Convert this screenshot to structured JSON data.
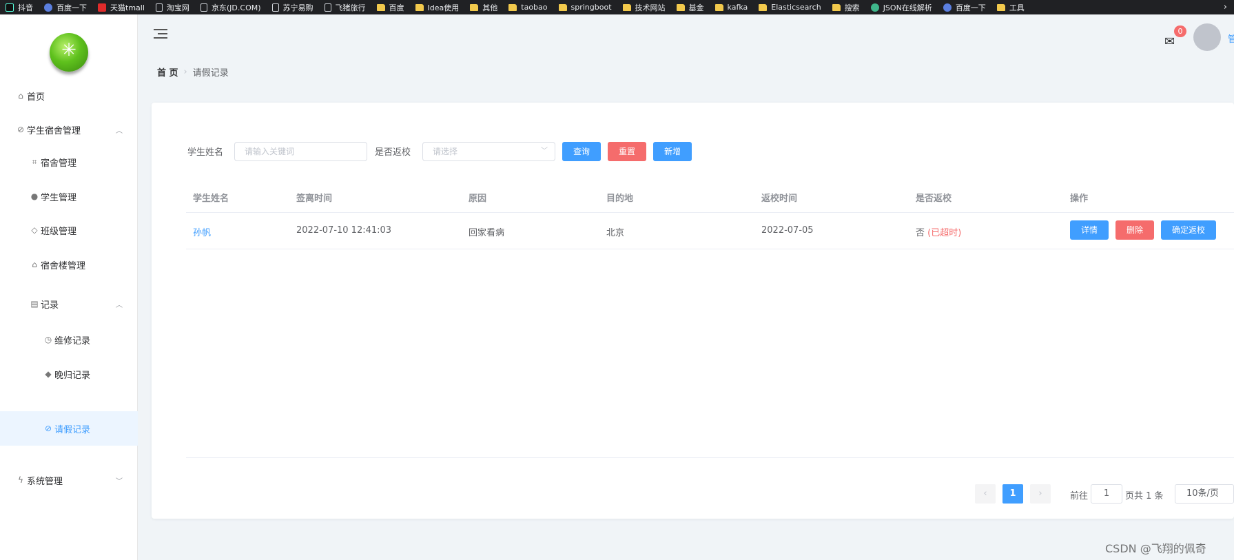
{
  "bookmarks": [
    {
      "label": "抖音",
      "icon": "tiktok-icon"
    },
    {
      "label": "百度一下",
      "icon": "paw-icon"
    },
    {
      "label": "天猫tmall",
      "icon": "tmall-icon"
    },
    {
      "label": "淘宝网",
      "icon": "page-icon"
    },
    {
      "label": "京东(JD.COM)",
      "icon": "page-icon"
    },
    {
      "label": "苏宁易购",
      "icon": "page-icon"
    },
    {
      "label": "飞猪旅行",
      "icon": "page-icon"
    },
    {
      "label": "百度",
      "icon": "folder-icon"
    },
    {
      "label": "Idea使用",
      "icon": "folder-icon"
    },
    {
      "label": "其他",
      "icon": "folder-icon"
    },
    {
      "label": "taobao",
      "icon": "folder-icon"
    },
    {
      "label": "springboot",
      "icon": "folder-icon"
    },
    {
      "label": "技术网站",
      "icon": "folder-icon"
    },
    {
      "label": "基金",
      "icon": "folder-icon"
    },
    {
      "label": "kafka",
      "icon": "folder-icon"
    },
    {
      "label": "Elasticsearch",
      "icon": "folder-icon"
    },
    {
      "label": "搜索",
      "icon": "folder-icon"
    },
    {
      "label": "JSON在线解析",
      "icon": "gear-icon"
    },
    {
      "label": "百度一下",
      "icon": "paw-icon"
    },
    {
      "label": "工具",
      "icon": "folder-icon"
    }
  ],
  "sidebar": {
    "home": "首页",
    "dorm_group": "学生宿舍管理",
    "dorm": "宿舍管理",
    "student": "学生管理",
    "class": "班级管理",
    "building": "宿舍楼管理",
    "records": "记录",
    "repair": "维修记录",
    "late": "晚归记录",
    "leave": "请假记录",
    "system": "系统管理"
  },
  "header": {
    "badge": "0",
    "cut_text": "管"
  },
  "breadcrumb": {
    "home": "首 页",
    "current": "请假记录"
  },
  "search": {
    "name_label": "学生姓名",
    "name_placeholder": "请输入关键词",
    "return_label": "是否返校",
    "return_placeholder": "请选择",
    "query": "查询",
    "reset": "重置",
    "add": "新增"
  },
  "table": {
    "headers": [
      "学生姓名",
      "签离时间",
      "原因",
      "目的地",
      "返校时间",
      "是否返校",
      "操作"
    ],
    "rows": [
      {
        "name": "孙帆",
        "leave_time": "2022-07-10 12:41:03",
        "reason": "回家看病",
        "destination": "北京",
        "return_time": "2022-07-05",
        "returned": "否",
        "overdue": "(已超时)",
        "actions": {
          "detail": "详情",
          "delete": "删除",
          "confirm": "确定返校"
        }
      }
    ]
  },
  "pagination": {
    "current": "1",
    "goto_label": "前往",
    "goto_value": "1",
    "total_text": "页共 1 条",
    "page_size": "10条/页"
  },
  "watermark": "CSDN @飞翔的佩奇"
}
